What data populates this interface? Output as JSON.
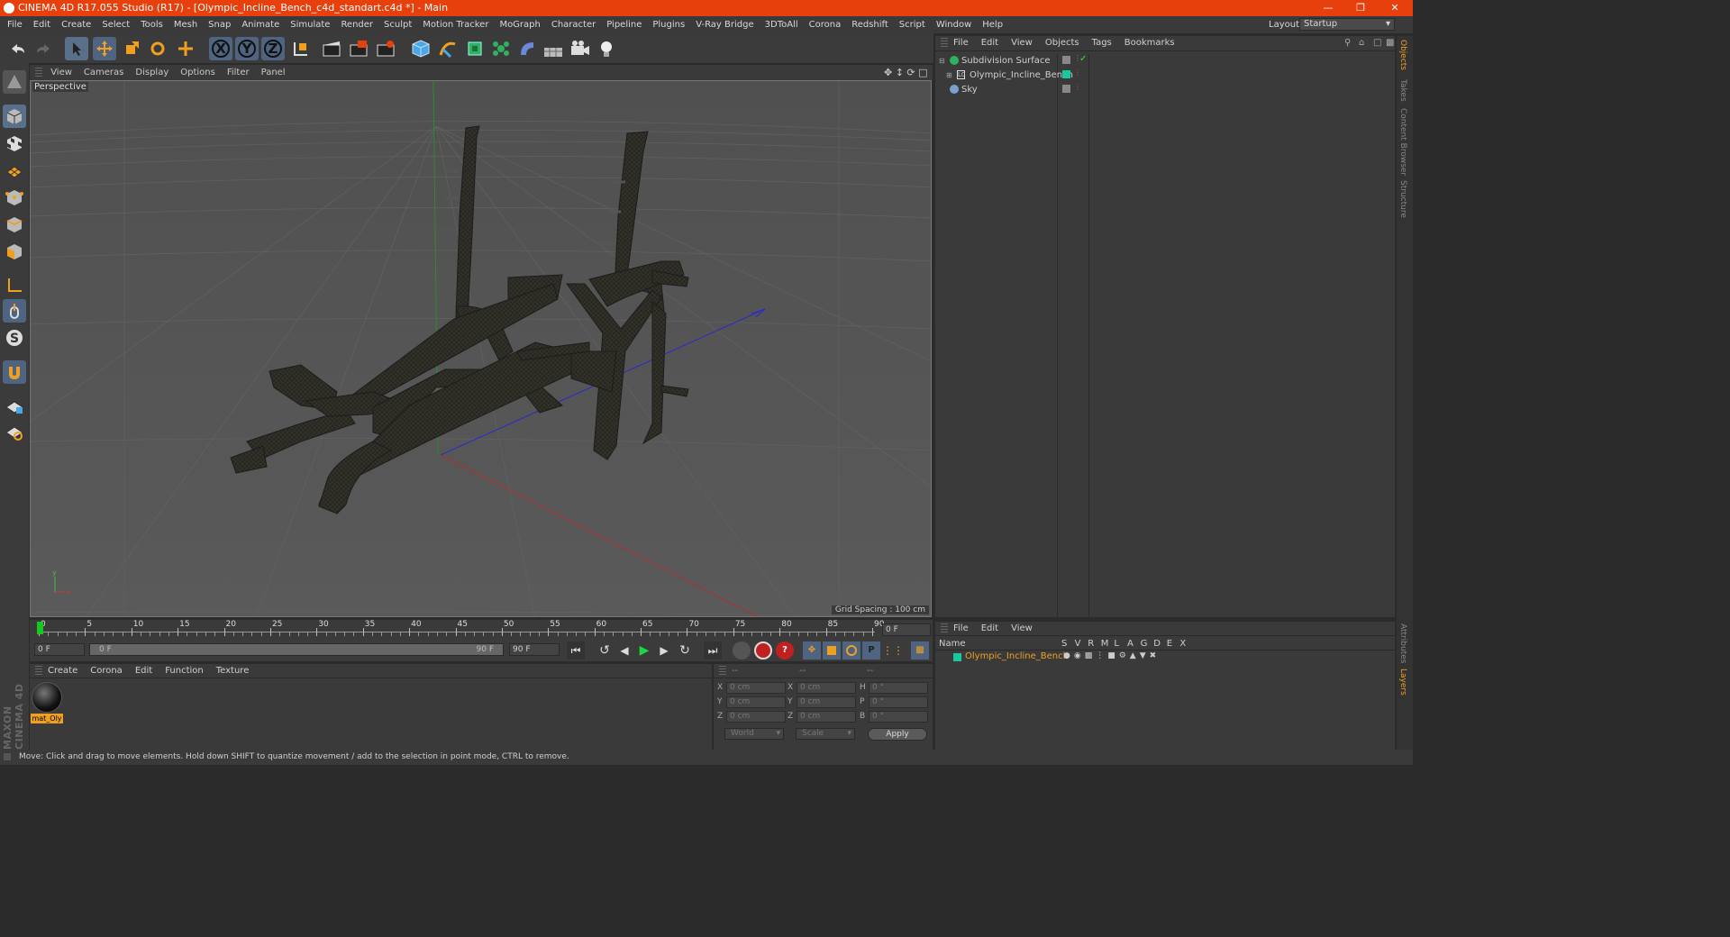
{
  "app": {
    "title": "CINEMA 4D R17.055 Studio (R17) - [Olympic_Incline_Bench_c4d_standart.c4d *] - Main",
    "layout_label": "Layout:",
    "layout_value": "Startup"
  },
  "menu": [
    "File",
    "Edit",
    "Create",
    "Select",
    "Tools",
    "Mesh",
    "Snap",
    "Animate",
    "Simulate",
    "Render",
    "Sculpt",
    "Motion Tracker",
    "MoGraph",
    "Character",
    "Pipeline",
    "Plugins",
    "V-Ray Bridge",
    "3DToAll",
    "Corona",
    "Redshift",
    "Script",
    "Window",
    "Help"
  ],
  "toolbar": {
    "axis_x": "X",
    "axis_y": "Y",
    "axis_z": "Z"
  },
  "viewport": {
    "menu": [
      "View",
      "Cameras",
      "Display",
      "Options",
      "Filter",
      "Panel"
    ],
    "camera_label": "Perspective",
    "grid_spacing": "Grid Spacing : 100 cm"
  },
  "timeline": {
    "ticks": [
      "0",
      "5",
      "10",
      "15",
      "20",
      "25",
      "30",
      "35",
      "40",
      "45",
      "50",
      "55",
      "60",
      "65",
      "70",
      "75",
      "80",
      "85",
      "90"
    ],
    "current_frame": "0 F",
    "start_field": "0 F",
    "range_start": "0 F",
    "range_end": "90 F",
    "end_field": "90 F"
  },
  "material_manager": {
    "menu": [
      "Create",
      "Corona",
      "Edit",
      "Function",
      "Texture"
    ],
    "material_name": "mat_Oly"
  },
  "coordinates": {
    "col_headers": [
      "--",
      "--",
      "--"
    ],
    "rows": [
      {
        "a": "X",
        "av": "0 cm",
        "b": "X",
        "bv": "0 cm",
        "c": "H",
        "cv": "0 °"
      },
      {
        "a": "Y",
        "av": "0 cm",
        "b": "Y",
        "bv": "0 cm",
        "c": "P",
        "cv": "0 °"
      },
      {
        "a": "Z",
        "av": "0 cm",
        "b": "Z",
        "bv": "0 cm",
        "c": "B",
        "cv": "0 °"
      }
    ],
    "space": "World",
    "mode": "Scale",
    "apply": "Apply"
  },
  "object_manager": {
    "menu": [
      "File",
      "Edit",
      "View",
      "Objects",
      "Tags",
      "Bookmarks"
    ],
    "objects": [
      "Subdivision Surface",
      "Olympic_Incline_Bench",
      "Sky"
    ]
  },
  "layer_manager": {
    "menu": [
      "File",
      "Edit",
      "View"
    ],
    "col_name": "Name",
    "cols": [
      "S",
      "V",
      "R",
      "M",
      "L",
      "A",
      "G",
      "D",
      "E",
      "X"
    ],
    "layer_name": "Olympic_Incline_Bench"
  },
  "right_tabs": [
    "Objects",
    "Takes",
    "Content Browser",
    "Structure"
  ],
  "right_tabs_bottom": [
    "Attributes",
    "Layers"
  ],
  "branding": "MAXON CINEMA 4D",
  "status": "Move: Click and drag to move elements. Hold down SHIFT to quantize movement / add to the selection in point mode, CTRL to remove.",
  "colors": {
    "titlebar": "#e8400c",
    "accent_orange": "#f0a020",
    "layer_green": "#18c8a0"
  }
}
